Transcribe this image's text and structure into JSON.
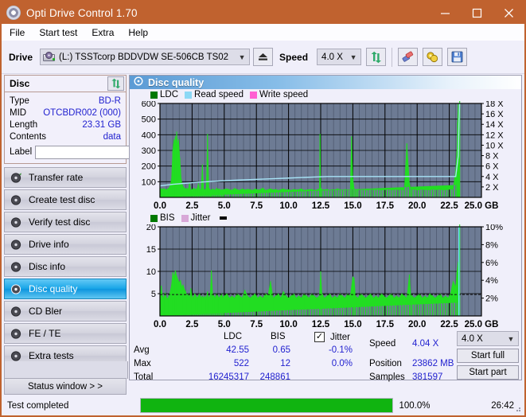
{
  "window": {
    "title": "Opti Drive Control 1.70",
    "icon": "disc-icon",
    "minimize": "minimize-icon",
    "maximize": "maximize-icon",
    "close": "close-icon",
    "accent_color": "#c0622f"
  },
  "menu": [
    "File",
    "Start test",
    "Extra",
    "Help"
  ],
  "toolbar": {
    "drive_label": "Drive",
    "drive_value": "(L:)  TSSTcorp BDDVDW SE-506CB TS02",
    "eject_icon": "eject-icon",
    "speed_label": "Speed",
    "speed_value": "4.0 X",
    "refresh_icon": "refresh-icon",
    "erase_icon": "eraser-icon",
    "tools_icon": "gold-coins-icon",
    "save_icon": "floppy-save-icon"
  },
  "disc_panel": {
    "title": "Disc",
    "refresh_icon": "refresh-icon",
    "rows": [
      {
        "key": "Type",
        "value": "BD-R"
      },
      {
        "key": "MID",
        "value": "OTCBDR002 (000)"
      },
      {
        "key": "Length",
        "value": "23.31 GB"
      },
      {
        "key": "Contents",
        "value": "data"
      }
    ],
    "label_key": "Label",
    "label_value": "",
    "label_placeholder": "",
    "label_button_icon": "disc-icon"
  },
  "nav": {
    "items": [
      {
        "label": "Transfer rate",
        "icon": "disc-test-icon",
        "active": false
      },
      {
        "label": "Create test disc",
        "icon": "disc-burn-icon",
        "active": false
      },
      {
        "label": "Verify test disc",
        "icon": "disc-verify-icon",
        "active": false
      },
      {
        "label": "Drive info",
        "icon": "drive-info-icon",
        "active": false
      },
      {
        "label": "Disc info",
        "icon": "disc-info-icon",
        "active": false
      },
      {
        "label": "Disc quality",
        "icon": "disc-quality-icon",
        "active": true
      },
      {
        "label": "CD Bler",
        "icon": "cd-bler-icon",
        "active": false
      },
      {
        "label": "FE / TE",
        "icon": "fe-te-icon",
        "active": false
      },
      {
        "label": "Extra tests",
        "icon": "extra-tests-icon",
        "active": false
      }
    ],
    "status_window": "Status window > >"
  },
  "panel": {
    "title": "Disc quality",
    "title_icon": "disc-quality-icon"
  },
  "stats": {
    "col_ldc": "LDC",
    "col_bis": "BIS",
    "row_avg": "Avg",
    "row_max": "Max",
    "row_total": "Total",
    "avg_ldc": "42.55",
    "avg_bis": "0.65",
    "max_ldc": "522",
    "max_bis": "12",
    "total_ldc": "16245317",
    "total_bis": "248861",
    "jitter_label": "Jitter",
    "jitter_checked": true,
    "jitter_avg": "-0.1%",
    "jitter_max": "0.0%",
    "speed_label": "Speed",
    "speed_value": "4.04 X",
    "position_label": "Position",
    "position_value": "23862 MB",
    "samples_label": "Samples",
    "samples_value": "381597",
    "speed_select": "4.0 X",
    "start_full": "Start full",
    "start_part": "Start part"
  },
  "statusbar": {
    "text": "Test completed",
    "percent_label": "100.0%",
    "progress": 100,
    "time": "26:42",
    "bar_color": "#10b410"
  },
  "chart_data": [
    {
      "type": "area",
      "name": "ldc-chart",
      "title": "Disc quality",
      "xlabel": "GB",
      "ylabel": "LDC",
      "xlim": [
        0,
        25
      ],
      "ylim": [
        0,
        600
      ],
      "y2lim": [
        0,
        18
      ],
      "y2label": "X",
      "xticks": [
        "0.0",
        "2.5",
        "5.0",
        "7.5",
        "10.0",
        "12.5",
        "15.0",
        "17.5",
        "20.0",
        "22.5",
        "25.0 GB"
      ],
      "yticks": [
        100,
        200,
        300,
        400,
        500,
        600
      ],
      "y2ticks": [
        "2 X",
        "4 X",
        "6 X",
        "8 X",
        "10 X",
        "12 X",
        "14 X",
        "16 X",
        "18 X"
      ],
      "grid": true,
      "legend": [
        {
          "label": "LDC",
          "color": "#00a000"
        },
        {
          "label": "Read speed",
          "color": "#8cd8f5"
        },
        {
          "label": "Write speed",
          "color": "#ff5fd2"
        }
      ],
      "plot_bg": "#6d7b94",
      "series": [
        {
          "name": "LDC",
          "color": "#22dd22",
          "x": [
            0.0,
            0.1,
            0.2,
            0.3,
            0.4,
            0.5,
            0.6,
            0.7,
            0.8,
            0.9,
            1.0,
            1.05,
            1.1,
            1.15,
            1.2,
            1.25,
            1.3,
            1.35,
            1.4,
            1.45,
            1.5,
            1.55,
            1.6,
            1.65,
            1.7,
            1.8,
            1.9,
            2.0,
            2.1,
            2.2,
            2.3,
            2.4,
            2.5,
            2.6,
            2.7,
            2.8,
            2.9,
            3.0,
            3.1,
            3.2,
            3.3,
            3.4,
            3.5,
            3.6,
            3.7,
            3.8,
            3.9,
            3.95,
            4.0,
            4.1,
            4.2,
            4.3,
            4.4,
            4.5,
            4.6,
            4.7,
            4.8,
            4.9,
            5.0,
            5.2,
            5.4,
            5.6,
            5.8,
            6.0,
            6.2,
            6.4,
            6.6,
            6.8,
            7.0,
            7.2,
            7.4,
            7.6,
            7.8,
            8.0,
            8.2,
            8.4,
            8.6,
            8.8,
            9.0,
            9.2,
            9.4,
            9.6,
            9.8,
            10.0,
            10.2,
            10.4,
            10.6,
            10.8,
            11.0,
            11.2,
            11.4,
            11.6,
            11.8,
            12.0,
            12.2,
            12.4,
            12.45,
            12.5,
            12.6,
            12.8,
            13.0,
            13.2,
            13.4,
            13.6,
            13.8,
            14.0,
            14.2,
            14.4,
            14.6,
            14.8,
            14.9,
            15.0,
            15.1,
            15.2,
            15.3,
            15.4,
            15.6,
            15.8,
            16.0,
            16.2,
            16.4,
            16.6,
            16.8,
            17.0,
            17.2,
            17.4,
            17.6,
            17.8,
            18.0,
            18.2,
            18.4,
            18.6,
            18.8,
            19.0,
            19.2,
            19.4,
            19.5,
            19.6,
            19.8,
            20.0,
            20.2,
            20.4,
            20.6,
            20.8,
            21.0,
            21.2,
            21.4,
            21.6,
            21.8,
            22.0,
            22.2,
            22.4,
            22.6,
            22.8,
            23.0,
            23.1,
            23.15,
            23.2,
            23.25,
            23.3,
            23.31
          ],
          "y": [
            60,
            55,
            50,
            58,
            52,
            48,
            55,
            60,
            75,
            120,
            300,
            340,
            370,
            330,
            390,
            350,
            420,
            360,
            330,
            370,
            300,
            250,
            180,
            120,
            95,
            70,
            60,
            55,
            58,
            50,
            95,
            45,
            50,
            60,
            55,
            50,
            60,
            90,
            48,
            52,
            210,
            55,
            45,
            60,
            405,
            60,
            50,
            45,
            48,
            55,
            50,
            45,
            60,
            50,
            55,
            45,
            50,
            48,
            52,
            55,
            50,
            45,
            58,
            50,
            45,
            55,
            48,
            52,
            50,
            45,
            55,
            48,
            50,
            60,
            45,
            50,
            55,
            48,
            52,
            45,
            50,
            55,
            48,
            50,
            45,
            52,
            48,
            50,
            55,
            45,
            48,
            50,
            52,
            45,
            48,
            55,
            405,
            60,
            50,
            48,
            52,
            45,
            50,
            48,
            55,
            50,
            45,
            52,
            48,
            50,
            390,
            120,
            55,
            48,
            50,
            45,
            52,
            48,
            50,
            45,
            55,
            48,
            50,
            52,
            45,
            50,
            48,
            55,
            45,
            50,
            52,
            48,
            50,
            45,
            345,
            90,
            50,
            48,
            55,
            45,
            50,
            52,
            48,
            50,
            45,
            55,
            48,
            50,
            52,
            45,
            50,
            48,
            55,
            50,
            180,
            300,
            480,
            600,
            250,
            80
          ]
        },
        {
          "name": "Read speed",
          "color": "#a8e4f7",
          "x": [
            0.0,
            1.0,
            2.0,
            3.0,
            4.0,
            5.0,
            6.0,
            7.0,
            8.0,
            9.0,
            10.0,
            11.0,
            12.0,
            13.0,
            14.0,
            15.0,
            16.0,
            17.0,
            18.0,
            19.0,
            20.0,
            21.0,
            22.0,
            23.0,
            23.2,
            23.25,
            23.3
          ],
          "y": [
            2.2,
            2.5,
            2.7,
            2.9,
            3.05,
            3.2,
            3.3,
            3.4,
            3.5,
            3.6,
            3.7,
            3.8,
            3.9,
            4.0,
            4.0,
            4.0,
            4.0,
            4.0,
            4.0,
            4.0,
            4.0,
            4.0,
            4.0,
            4.0,
            8.0,
            14.0,
            18.0
          ]
        }
      ]
    },
    {
      "type": "area",
      "name": "bis-chart",
      "xlabel": "GB",
      "ylabel": "BIS",
      "xlim": [
        0,
        25
      ],
      "ylim": [
        0,
        20
      ],
      "y2lim": [
        0,
        10
      ],
      "y2label": "%",
      "xticks": [
        "0.0",
        "2.5",
        "5.0",
        "7.5",
        "10.0",
        "12.5",
        "15.0",
        "17.5",
        "20.0",
        "22.5",
        "25.0 GB"
      ],
      "yticks": [
        5,
        10,
        15,
        20
      ],
      "y2ticks": [
        "2%",
        "4%",
        "6%",
        "8%",
        "10%"
      ],
      "grid": true,
      "legend": [
        {
          "label": "BIS",
          "color": "#00a000"
        },
        {
          "label": "Jitter",
          "color": "#d8a8d8"
        }
      ],
      "plot_bg": "#6d7b94",
      "series": [
        {
          "name": "BIS",
          "color": "#22dd22",
          "x": [
            0.0,
            0.1,
            0.2,
            0.3,
            0.4,
            0.5,
            0.6,
            0.7,
            0.8,
            0.9,
            1.0,
            1.1,
            1.2,
            1.3,
            1.4,
            1.5,
            1.6,
            1.7,
            1.8,
            1.9,
            2.0,
            2.1,
            2.2,
            2.3,
            2.4,
            2.5,
            2.6,
            2.7,
            2.8,
            2.9,
            3.0,
            3.1,
            3.2,
            3.3,
            3.4,
            3.5,
            3.6,
            3.7,
            3.8,
            3.9,
            4.0,
            4.1,
            4.2,
            4.3,
            4.4,
            4.5,
            4.6,
            4.7,
            4.8,
            4.9,
            5.0,
            5.2,
            5.4,
            5.6,
            5.8,
            6.0,
            6.2,
            6.4,
            6.6,
            6.8,
            7.0,
            7.2,
            7.4,
            7.6,
            7.8,
            8.0,
            8.2,
            8.4,
            8.6,
            8.8,
            9.0,
            9.2,
            9.4,
            9.6,
            9.8,
            10.0,
            10.2,
            10.4,
            10.6,
            10.8,
            11.0,
            11.2,
            11.4,
            11.6,
            11.8,
            12.0,
            12.2,
            12.4,
            12.5,
            12.6,
            12.8,
            13.0,
            13.2,
            13.4,
            13.6,
            13.8,
            14.0,
            14.2,
            14.4,
            14.6,
            14.8,
            15.0,
            15.1,
            15.2,
            15.4,
            15.6,
            15.8,
            16.0,
            16.2,
            16.4,
            16.6,
            16.8,
            17.0,
            17.2,
            17.4,
            17.6,
            17.8,
            18.0,
            18.2,
            18.4,
            18.6,
            18.8,
            19.0,
            19.2,
            19.4,
            19.5,
            19.6,
            19.8,
            20.0,
            20.2,
            20.4,
            20.6,
            20.8,
            21.0,
            21.2,
            21.4,
            21.6,
            21.8,
            22.0,
            22.2,
            22.4,
            22.6,
            22.8,
            23.0,
            23.1,
            23.2,
            23.25,
            23.3,
            23.31
          ],
          "y": [
            3.5,
            6.8,
            4.5,
            4.0,
            5.2,
            4.2,
            3.8,
            4.5,
            5.5,
            7.0,
            9.8,
            8.8,
            10.2,
            9.0,
            8.2,
            7.5,
            8.0,
            6.5,
            7.0,
            6.0,
            5.5,
            4.5,
            5.0,
            4.0,
            6.2,
            4.5,
            4.0,
            5.0,
            4.5,
            4.0,
            4.5,
            5.0,
            4.0,
            4.5,
            4.0,
            4.5,
            4.0,
            5.5,
            4.0,
            4.5,
            10.2,
            5.0,
            4.5,
            4.0,
            5.0,
            4.5,
            4.0,
            4.5,
            5.0,
            4.0,
            4.5,
            5.0,
            4.0,
            4.5,
            4.0,
            5.0,
            4.5,
            4.0,
            5.8,
            4.5,
            4.0,
            4.5,
            5.0,
            4.0,
            4.5,
            4.0,
            5.0,
            4.5,
            7.8,
            4.0,
            4.5,
            5.0,
            4.0,
            5.5,
            4.5,
            4.0,
            4.5,
            5.0,
            4.0,
            4.5,
            4.0,
            5.0,
            4.5,
            4.0,
            5.0,
            4.5,
            4.0,
            4.5,
            10.0,
            5.0,
            4.0,
            4.5,
            5.0,
            4.0,
            4.5,
            4.0,
            5.0,
            4.5,
            4.0,
            5.0,
            4.5,
            8.8,
            8.5,
            4.5,
            4.0,
            5.0,
            4.5,
            4.0,
            4.5,
            5.0,
            4.0,
            4.5,
            4.0,
            5.0,
            4.5,
            4.0,
            4.5,
            5.0,
            4.0,
            4.5,
            4.0,
            5.0,
            4.5,
            4.0,
            9.3,
            5.0,
            4.5,
            4.0,
            4.5,
            5.0,
            4.0,
            4.5,
            4.0,
            5.0,
            4.5,
            4.0,
            4.5,
            5.0,
            4.0,
            4.5,
            4.0,
            5.0,
            7.8,
            6.5,
            10.0,
            12.2,
            8.0,
            3.0
          ]
        }
      ]
    }
  ]
}
